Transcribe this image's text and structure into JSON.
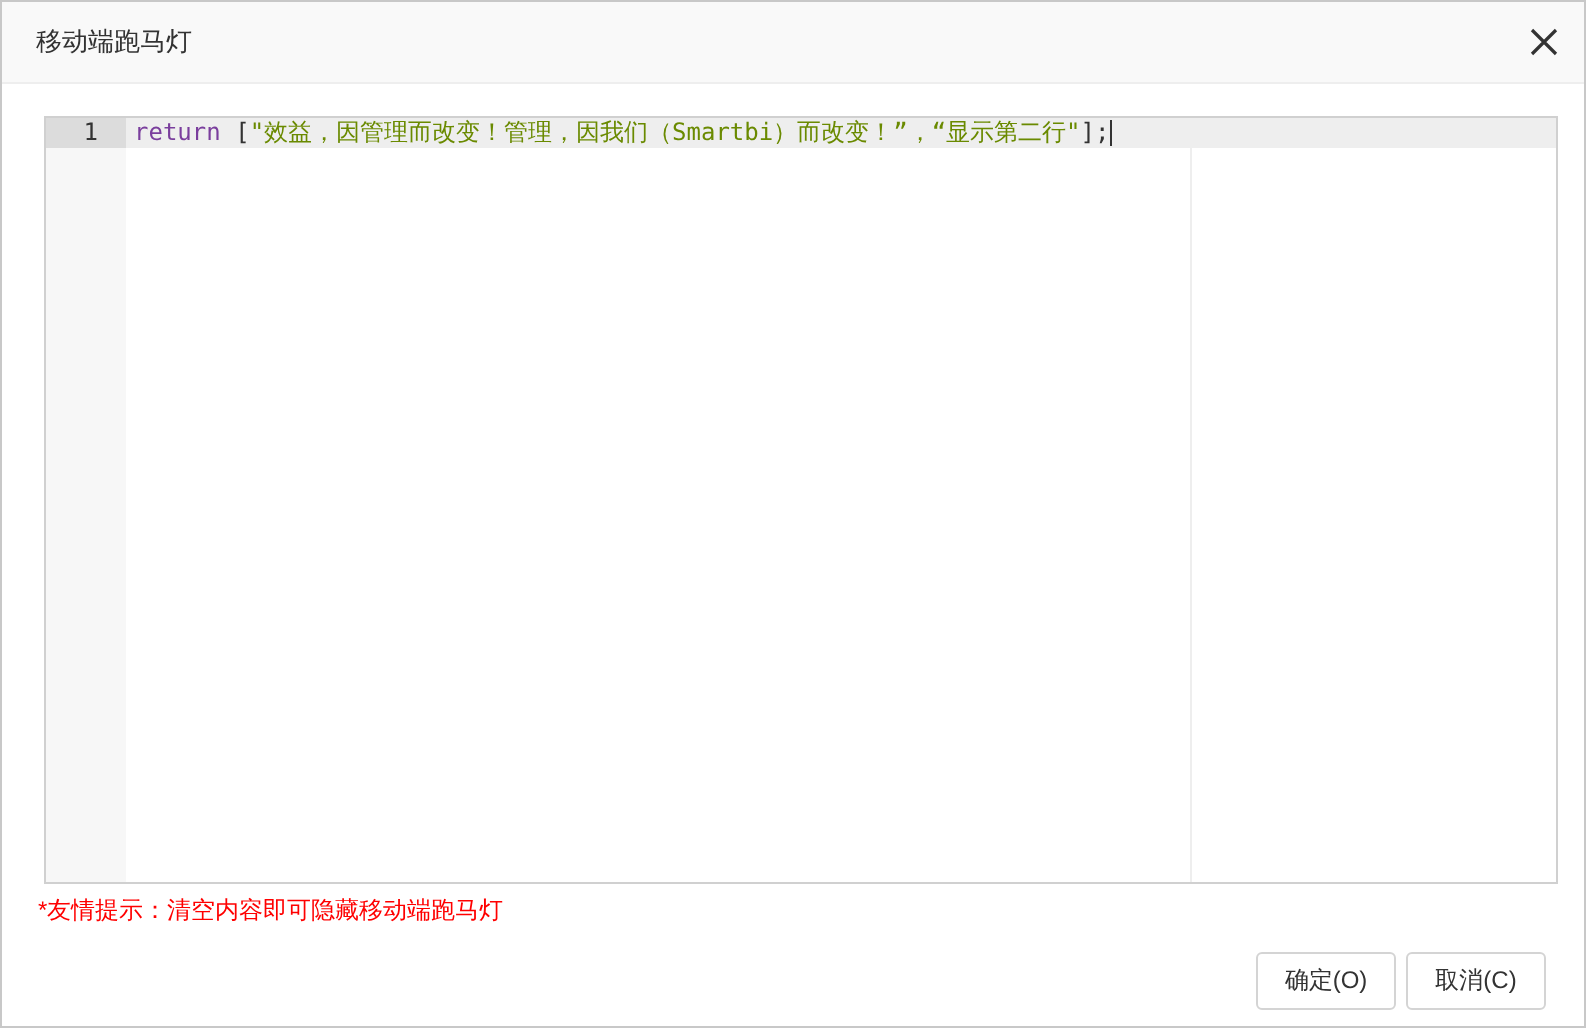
{
  "dialog": {
    "title": "移动端跑马灯"
  },
  "editor": {
    "lines": [
      {
        "number": "1",
        "active": true,
        "tokens": [
          {
            "kind": "keyword",
            "text": "return"
          },
          {
            "kind": "punct",
            "text": " ["
          },
          {
            "kind": "string",
            "text": "\"效益，因管理而改变！管理，因我们（Smartbi）而改变！”，“显示第二行\""
          },
          {
            "kind": "punct",
            "text": "];"
          }
        ]
      }
    ]
  },
  "hint": "*友情提示：清空内容即可隐藏移动端跑马灯",
  "buttons": [
    "确定(O)",
    "取消(C)"
  ]
}
